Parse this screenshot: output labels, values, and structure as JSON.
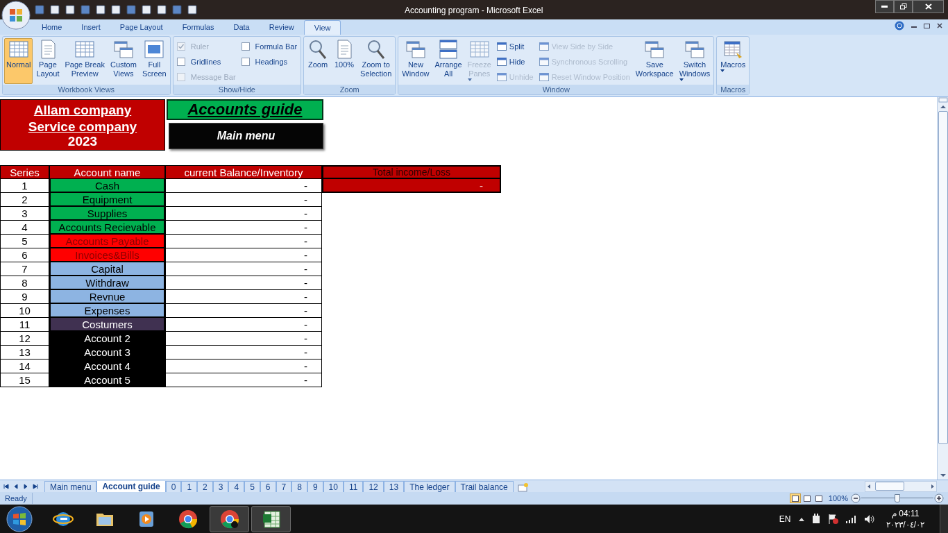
{
  "window": {
    "title": "Accounting program - Microsoft Excel"
  },
  "ribbon_tabs": [
    {
      "label": "Home",
      "selected": false
    },
    {
      "label": "Insert",
      "selected": false
    },
    {
      "label": "Page Layout",
      "selected": false
    },
    {
      "label": "Formulas",
      "selected": false
    },
    {
      "label": "Data",
      "selected": false
    },
    {
      "label": "Review",
      "selected": false
    },
    {
      "label": "View",
      "selected": true
    }
  ],
  "ribbon_groups": [
    {
      "title": "Workbook Views",
      "items": [
        {
          "kind": "large",
          "lines": [
            "Normal"
          ],
          "selected": true
        },
        {
          "kind": "large",
          "lines": [
            "Page",
            "Layout"
          ],
          "selected": false
        },
        {
          "kind": "large",
          "lines": [
            "Page Break",
            "Preview"
          ],
          "selected": false
        },
        {
          "kind": "large",
          "lines": [
            "Custom",
            "Views"
          ],
          "selected": false
        },
        {
          "kind": "large",
          "lines": [
            "Full",
            "Screen"
          ],
          "selected": false
        }
      ]
    },
    {
      "title": "Show/Hide",
      "items": [
        {
          "kind": "check",
          "label": "Ruler",
          "checked": true,
          "disabled": true
        },
        {
          "kind": "check",
          "label": "Gridlines",
          "checked": false,
          "disabled": false
        },
        {
          "kind": "check",
          "label": "Message Bar",
          "checked": false,
          "disabled": true
        },
        {
          "kind": "check",
          "label": "Formula Bar",
          "checked": false,
          "disabled": false
        },
        {
          "kind": "check",
          "label": "Headings",
          "checked": false,
          "disabled": false
        }
      ]
    },
    {
      "title": "Zoom",
      "items": [
        {
          "kind": "large",
          "lines": [
            "Zoom"
          ]
        },
        {
          "kind": "large",
          "lines": [
            "100%"
          ]
        },
        {
          "kind": "large",
          "lines": [
            "Zoom to",
            "Selection"
          ]
        }
      ]
    },
    {
      "title": "Window",
      "items": [
        {
          "kind": "large",
          "lines": [
            "New",
            "Window"
          ]
        },
        {
          "kind": "large",
          "lines": [
            "Arrange",
            "All"
          ]
        },
        {
          "kind": "large",
          "lines": [
            "Freeze",
            "Panes"
          ],
          "disabled": true,
          "dropdown": true
        },
        {
          "kind": "small",
          "label": "Split",
          "disabled": false
        },
        {
          "kind": "small",
          "label": "Hide",
          "disabled": false
        },
        {
          "kind": "small",
          "label": "Unhide",
          "disabled": true
        },
        {
          "kind": "small",
          "label": "View Side by Side",
          "disabled": true
        },
        {
          "kind": "small",
          "label": "Synchronous Scrolling",
          "disabled": true
        },
        {
          "kind": "small",
          "label": "Reset Window Position",
          "disabled": true
        },
        {
          "kind": "large",
          "lines": [
            "Save",
            "Workspace"
          ]
        },
        {
          "kind": "large",
          "lines": [
            "Switch",
            "Windows"
          ],
          "dropdown": true
        }
      ]
    },
    {
      "title": "Macros",
      "items": [
        {
          "kind": "large",
          "lines": [
            "Macros"
          ],
          "dropdown": true
        }
      ]
    }
  ],
  "sheet": {
    "company": "Allam company",
    "subtitle": "Service company",
    "year": "2023",
    "guide_title": "Accounts guide",
    "menu_button": "Main menu",
    "table": {
      "columns": [
        "Series",
        "Account name",
        "current Balance/Inventory"
      ],
      "total": {
        "label": "Total income/Loss",
        "value": "-"
      },
      "rows": [
        {
          "series": "1",
          "name": "Cash",
          "color": "#00b050",
          "balance": "-"
        },
        {
          "series": "2",
          "name": "Equipment",
          "color": "#00b050",
          "balance": "-"
        },
        {
          "series": "3",
          "name": "Supplies",
          "color": "#00b050",
          "balance": "-"
        },
        {
          "series": "4",
          "name": "Accounts Recievable",
          "color": "#00b050",
          "balance": "-"
        },
        {
          "series": "5",
          "name": "Accounts Payable",
          "color": "#ff0000",
          "balance": "-"
        },
        {
          "series": "6",
          "name": "Invoices&Bills",
          "color": "#ff0000",
          "balance": "-"
        },
        {
          "series": "7",
          "name": "Capital",
          "color": "#8db4e2",
          "balance": "-"
        },
        {
          "series": "8",
          "name": "Withdraw",
          "color": "#8db4e2",
          "balance": "-"
        },
        {
          "series": "9",
          "name": "Revnue",
          "color": "#8db4e2",
          "balance": "-"
        },
        {
          "series": "10",
          "name": "Expenses",
          "color": "#8db4e2",
          "balance": "-"
        },
        {
          "series": "11",
          "name": "Costumers",
          "color": "#403151",
          "balance": "-"
        },
        {
          "series": "12",
          "name": "Account 2",
          "color": "#000000",
          "balance": "-"
        },
        {
          "series": "13",
          "name": "Account 3",
          "color": "#000000",
          "balance": "-"
        },
        {
          "series": "14",
          "name": "Account 4",
          "color": "#000000",
          "balance": "-"
        },
        {
          "series": "15",
          "name": "Account 5",
          "color": "#000000",
          "balance": "-"
        }
      ]
    }
  },
  "sheet_tabs": [
    {
      "label": "Main menu",
      "selected": false
    },
    {
      "label": "Account guide",
      "selected": true
    },
    {
      "label": "0",
      "selected": false
    },
    {
      "label": "1",
      "selected": false
    },
    {
      "label": "2",
      "selected": false
    },
    {
      "label": "3",
      "selected": false
    },
    {
      "label": "4",
      "selected": false
    },
    {
      "label": "5",
      "selected": false
    },
    {
      "label": "6",
      "selected": false
    },
    {
      "label": "7",
      "selected": false
    },
    {
      "label": "8",
      "selected": false
    },
    {
      "label": "9",
      "selected": false
    },
    {
      "label": "10",
      "selected": false
    },
    {
      "label": "11",
      "selected": false
    },
    {
      "label": "12",
      "selected": false
    },
    {
      "label": "13",
      "selected": false
    },
    {
      "label": "The ledger",
      "selected": false
    },
    {
      "label": "Trail balance",
      "selected": false
    }
  ],
  "status_bar": {
    "status": "Ready",
    "view_buttons": [
      {
        "selected": true
      },
      {
        "selected": false
      },
      {
        "selected": false
      }
    ],
    "zoom": "100%",
    "zoom_slider": {
      "level": 0.5
    }
  },
  "taskbar": {
    "apps": [
      {
        "open": false
      },
      {
        "open": false
      },
      {
        "open": false
      },
      {
        "open": false
      },
      {
        "open": true
      },
      {
        "open": true
      }
    ],
    "language": "EN",
    "time": "04:11 م",
    "date": "٢٠٢٣/٠٤/٠٢"
  }
}
